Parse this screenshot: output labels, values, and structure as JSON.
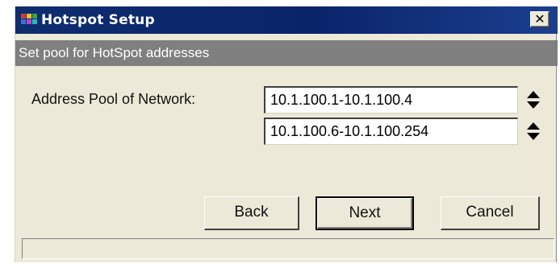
{
  "window": {
    "title": "Hotspot Setup",
    "close_glyph": "✕",
    "app_icon": "winbox-app-icon"
  },
  "step": {
    "subtitle": "Set pool for HotSpot addresses"
  },
  "form": {
    "pool_label": "Address Pool of Network:",
    "pools": [
      {
        "value": "10.1.100.1-10.1.100.4"
      },
      {
        "value": "10.1.100.6-10.1.100.254"
      }
    ],
    "spinner_icon": "up-down-spinner-icon"
  },
  "buttons": {
    "back": "Back",
    "next": "Next",
    "cancel": "Cancel"
  },
  "status": {
    "text": ""
  },
  "colors": {
    "titlebar": "#0a246a",
    "subtitle_bg": "#7f7f7f",
    "dialog_bg": "#ece9d8"
  }
}
